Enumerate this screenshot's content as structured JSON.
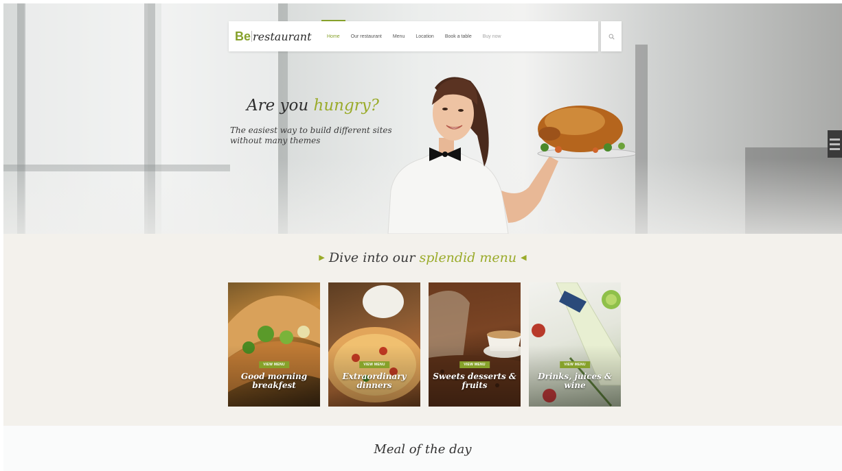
{
  "brand": {
    "be": "Be",
    "restaurant": "restaurant"
  },
  "nav": {
    "items": [
      {
        "label": "Home",
        "active": true
      },
      {
        "label": "Our restaurant"
      },
      {
        "label": "Menu"
      },
      {
        "label": "Location"
      },
      {
        "label": "Book a table"
      },
      {
        "label": "Buy now"
      }
    ],
    "search_icon": "search-icon"
  },
  "hero": {
    "headline_part1": "Are you ",
    "headline_accent": "hungry?",
    "subline": "The easiest way to build different sites without many themes"
  },
  "menu_section": {
    "title_part1": "Dive into our ",
    "title_accent": "splendid menu",
    "cards": [
      {
        "button": "VIEW MENU",
        "caption": "Good morning breakfest"
      },
      {
        "button": "VIEW MENU",
        "caption": "Extraordinary dinners"
      },
      {
        "button": "VIEW MENU",
        "caption": "Sweets desserts & fruits"
      },
      {
        "button": "VIEW MENU",
        "caption": "Drinks, juices & wine"
      }
    ]
  },
  "meal_section": {
    "title": "Meal of the day"
  },
  "colors": {
    "accent": "#86a12a",
    "section_bg": "#f3f1ec"
  }
}
